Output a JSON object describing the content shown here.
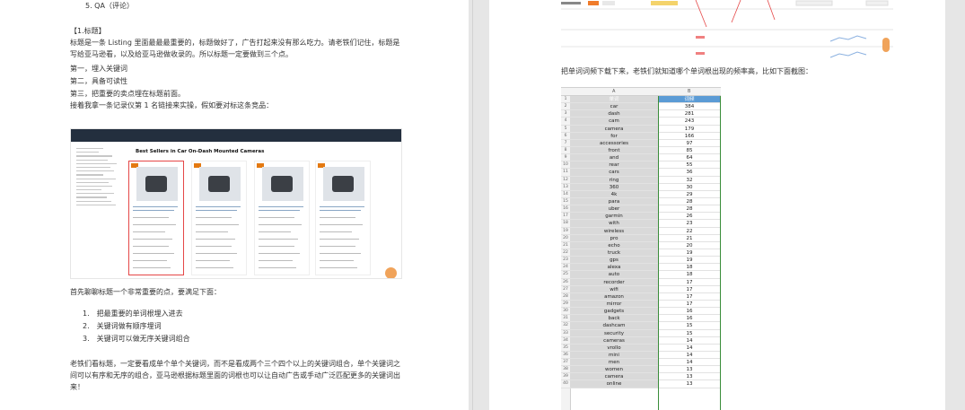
{
  "left_page": {
    "item5": "5.   QA（评论）",
    "heading": "【1.标题】",
    "para1_line1": "标题是一条 Listing 里面最最最重要的，标题做好了，广告打起来没有那么吃力。请老铁们记住，标题是",
    "para1_line2": "写给亚马逊看，以及给亚马逊做收录的。所以标题一定要做到三个点。",
    "point1": "第一，埋入关键词",
    "point2": "第二，具备可读性",
    "point3": "第三，把重要的卖点埋在标题前面。",
    "para2": "接着我拿一条记录仪第 1 名链接来实操，假如要对标这条竞品：",
    "screenshot_title": "Best Sellers in Car On-Dash Mounted Cameras",
    "para3": "首先聊聊标题一个非常重要的点，要满足下面：",
    "list": [
      {
        "num": "1.",
        "text": "把最重要的单词根埋入进去"
      },
      {
        "num": "2.",
        "text": "关键词做有顺序埋词"
      },
      {
        "num": "3.",
        "text": "关键词可以做无序关键词组合"
      }
    ],
    "para4_line1": "老铁们看标题，一定要看成单个单个关键词，而不是看成两个三个四个以上的关键词组合，单个关键词之",
    "para4_line2": "间可以有序和无序的组合，亚马逊根据标题里面的词根也可以让自动广告或手动广泛匹配更多的关键词出",
    "para4_line3": "来！"
  },
  "right_page": {
    "caption": "把单词词频下载下来，老铁们就知道哪个单词根出现的频率高，比如下面截图：",
    "sheet": {
      "col_a_header": "单词",
      "col_b_header": "词频",
      "col_a_letter": "A",
      "col_b_letter": "B",
      "rows": [
        [
          "car",
          "384"
        ],
        [
          "dash",
          "281"
        ],
        [
          "cam",
          "243"
        ],
        [
          "camera",
          "179"
        ],
        [
          "for",
          "166"
        ],
        [
          "accessories",
          "97"
        ],
        [
          "front",
          "85"
        ],
        [
          "and",
          "64"
        ],
        [
          "rear",
          "55"
        ],
        [
          "cars",
          "36"
        ],
        [
          "ring",
          "32"
        ],
        [
          "360",
          "30"
        ],
        [
          "4k",
          "29"
        ],
        [
          "para",
          "28"
        ],
        [
          "uber",
          "28"
        ],
        [
          "garmin",
          "26"
        ],
        [
          "with",
          "23"
        ],
        [
          "wireless",
          "22"
        ],
        [
          "pro",
          "21"
        ],
        [
          "echo",
          "20"
        ],
        [
          "truck",
          "19"
        ],
        [
          "gps",
          "19"
        ],
        [
          "alexa",
          "18"
        ],
        [
          "auto",
          "18"
        ],
        [
          "recorder",
          "17"
        ],
        [
          "wifi",
          "17"
        ],
        [
          "amazon",
          "17"
        ],
        [
          "mirror",
          "17"
        ],
        [
          "gadgets",
          "16"
        ],
        [
          "back",
          "16"
        ],
        [
          "dashcam",
          "15"
        ],
        [
          "security",
          "15"
        ],
        [
          "cameras",
          "14"
        ],
        [
          "vrollo",
          "14"
        ],
        [
          "mini",
          "14"
        ],
        [
          "men",
          "14"
        ],
        [
          "women",
          "13"
        ],
        [
          "camera",
          "13"
        ],
        [
          "online",
          "13"
        ]
      ]
    }
  },
  "colors": {
    "header_blue": "#5b9bd5",
    "column_gray": "#d9d9d9",
    "selection_green": "#3a8d3a",
    "amazon_dark": "#232f3e"
  }
}
